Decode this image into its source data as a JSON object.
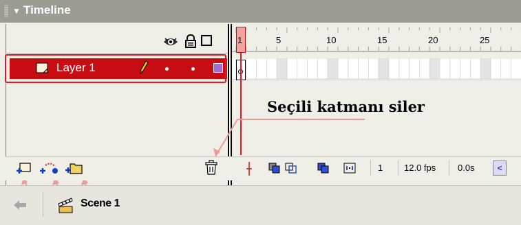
{
  "panel": {
    "title": "Timeline"
  },
  "layers": [
    {
      "name": "Layer 1",
      "selected": true,
      "color": "#a46bd0"
    }
  ],
  "ruler": {
    "playhead_frame": "1",
    "labels": [
      "5",
      "10",
      "15",
      "20",
      "25"
    ]
  },
  "annotation": {
    "text": "Seçili katmanı siler"
  },
  "status": {
    "current_frame": "1",
    "fps": "12.0 fps",
    "elapsed": "0.0s"
  },
  "scene": {
    "name": "Scene 1"
  },
  "icons": {
    "header": [
      "eye-icon",
      "lock-icon",
      "outline-icon"
    ],
    "layer_row": [
      "layer-icon",
      "pencil-icon"
    ],
    "bottom_left": [
      "insert-layer-icon",
      "add-motion-guide-icon",
      "insert-layer-folder-icon"
    ],
    "bottom_right": [
      "trash-icon"
    ],
    "onion": [
      "center-frame-icon",
      "onion-skin-icon",
      "onion-skin-outlines-icon",
      "edit-multiple-frames-icon",
      "modify-onion-markers-icon"
    ],
    "scene_bar": [
      "back-arrow-icon",
      "clapper-icon"
    ]
  },
  "colors": {
    "selected_layer": "#c80d12",
    "highlight": "#e8141e",
    "title_bar": "#9c9c94"
  }
}
